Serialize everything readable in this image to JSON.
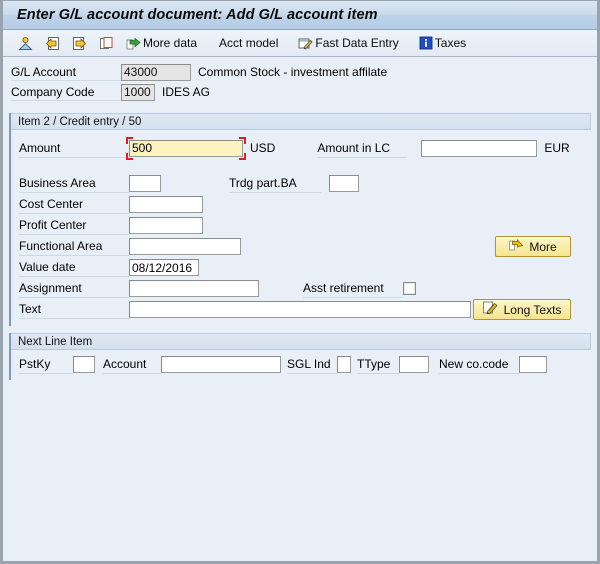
{
  "window": {
    "title": "Enter G/L account document: Add G/L account item"
  },
  "toolbar": {
    "items": [
      {
        "icon": "partner-icon",
        "label": ""
      },
      {
        "icon": "previous-item-icon",
        "label": ""
      },
      {
        "icon": "next-item-icon",
        "label": ""
      },
      {
        "icon": "copy-icon",
        "label": ""
      },
      {
        "icon": "more-data-icon",
        "label": "More data"
      },
      {
        "icon": "",
        "label": "Acct model"
      },
      {
        "icon": "fast-data-entry-icon",
        "label": "Fast Data Entry"
      },
      {
        "icon": "taxes-icon",
        "label": "Taxes"
      }
    ]
  },
  "header": {
    "gl_account": {
      "label": "G/L Account",
      "value": "43000",
      "description": "Common Stock - investment affilate"
    },
    "company_code": {
      "label": "Company Code",
      "value": "1000",
      "description": "IDES AG"
    }
  },
  "item_group": {
    "title": "Item 2 / Credit entry / 50",
    "amount": {
      "label": "Amount",
      "value": "500",
      "currency": "USD"
    },
    "amount_lc": {
      "label": "Amount in LC",
      "value": "",
      "currency": "EUR"
    },
    "business_area": {
      "label": "Business Area",
      "value": ""
    },
    "trdg_part_ba": {
      "label": "Trdg part.BA",
      "value": ""
    },
    "cost_center": {
      "label": "Cost Center",
      "value": ""
    },
    "profit_center": {
      "label": "Profit Center",
      "value": ""
    },
    "functional_area": {
      "label": "Functional Area",
      "value": ""
    },
    "value_date": {
      "label": "Value date",
      "value": "08/12/2016"
    },
    "assignment": {
      "label": "Assignment",
      "value": ""
    },
    "asst_retirement": {
      "label": "Asst retirement",
      "checked": false
    },
    "text": {
      "label": "Text",
      "value": ""
    },
    "more_button": {
      "label": "More"
    },
    "long_texts_button": {
      "label": "Long Texts"
    }
  },
  "next_line_item": {
    "title": "Next Line Item",
    "pstky": {
      "label": "PstKy",
      "value": ""
    },
    "account": {
      "label": "Account",
      "value": ""
    },
    "sgl_ind": {
      "label": "SGL Ind",
      "value": ""
    },
    "ttype": {
      "label": "TType",
      "value": ""
    },
    "new_co_code": {
      "label": "New co.code",
      "value": ""
    }
  },
  "colors": {
    "title_bar": "#c9daec",
    "background": "#e9eff6",
    "focus_field": "#fdf3c0",
    "focus_marker": "#e02020",
    "button": "#f6e58f",
    "group_border": "#7a9cc4"
  }
}
